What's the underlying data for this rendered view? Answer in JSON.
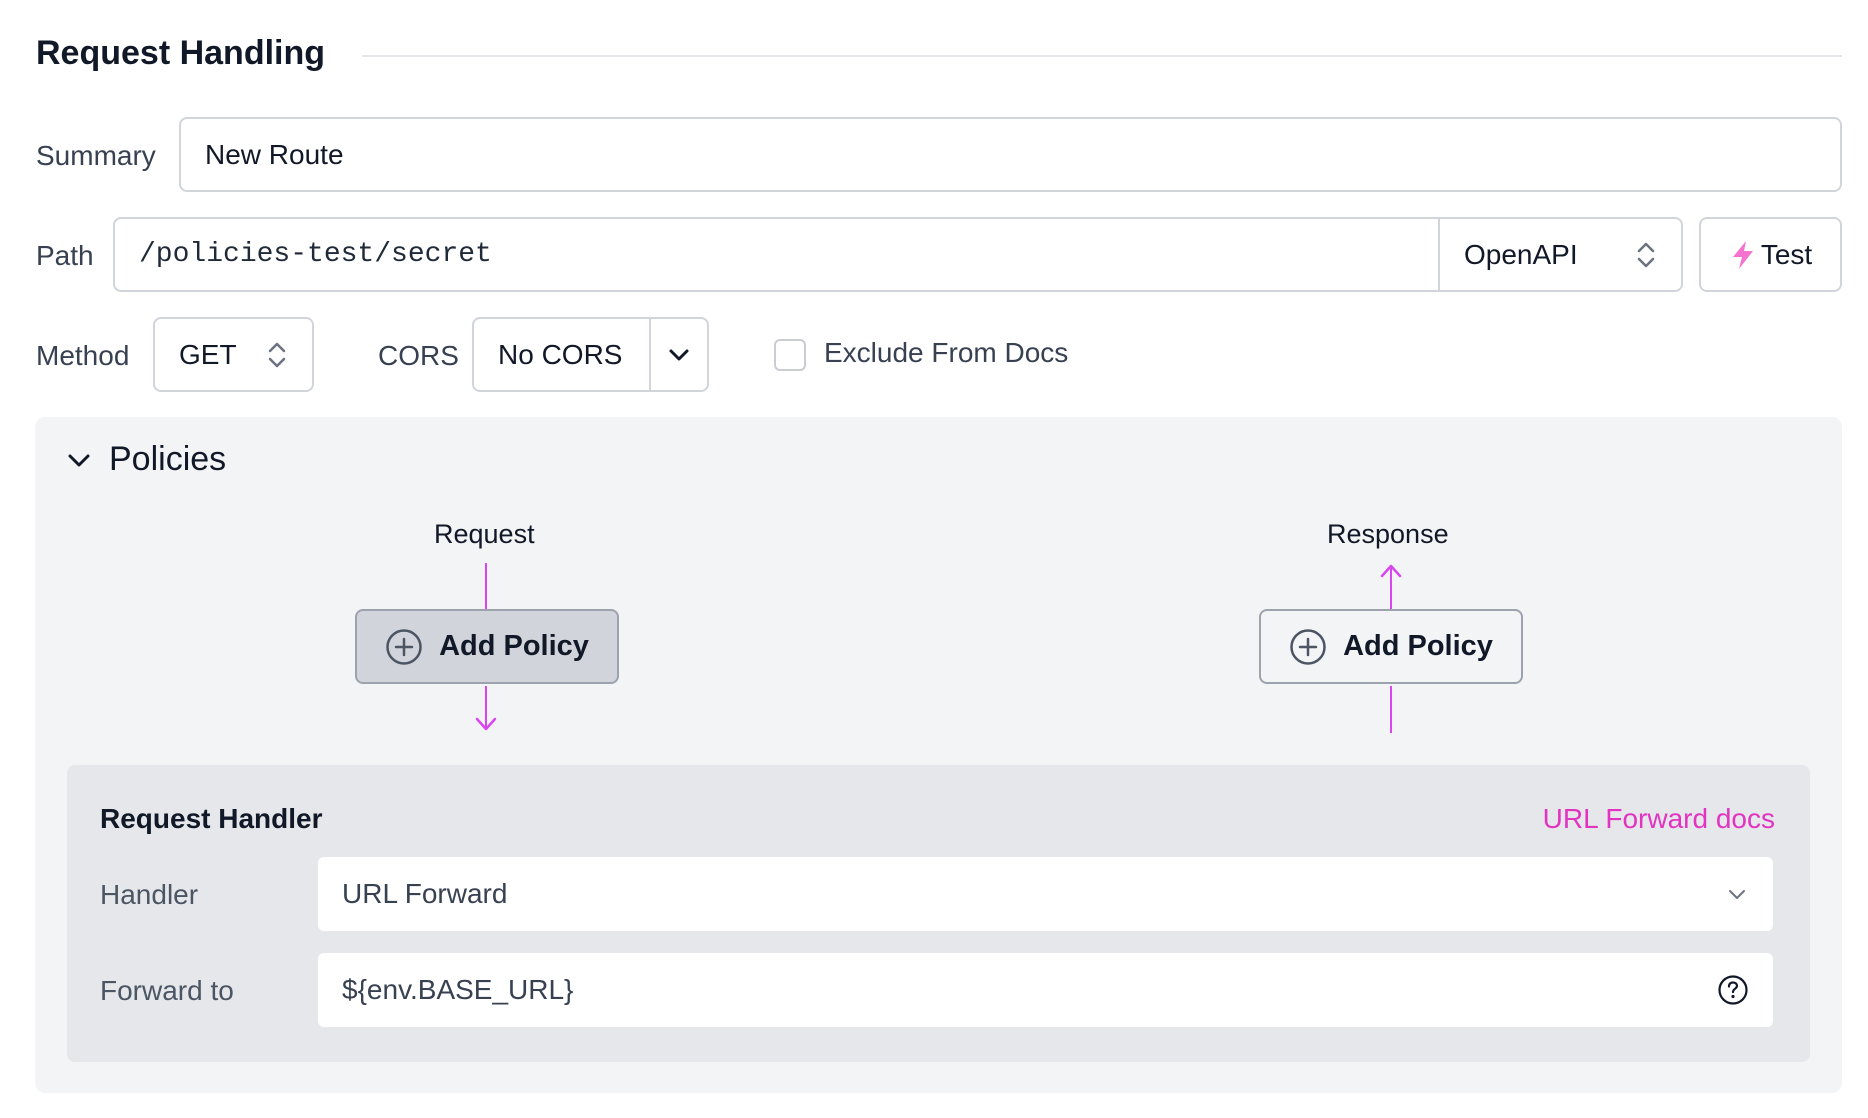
{
  "section": {
    "title": "Request Handling"
  },
  "summary": {
    "label": "Summary",
    "value": "New Route"
  },
  "path": {
    "label": "Path",
    "value": "/policies-test/secret",
    "spec_select": "OpenAPI",
    "test_label": "Test"
  },
  "method": {
    "label": "Method",
    "value": "GET"
  },
  "cors": {
    "label": "CORS",
    "value": "No CORS"
  },
  "exclude_docs": {
    "label": "Exclude From Docs",
    "checked": false
  },
  "policies": {
    "title": "Policies",
    "request_label": "Request",
    "response_label": "Response",
    "add_policy_label": "Add Policy"
  },
  "request_handler": {
    "title": "Request Handler",
    "docs_link": "URL Forward docs",
    "handler_label": "Handler",
    "handler_value": "URL Forward",
    "forward_label": "Forward to",
    "forward_value": "${env.BASE_URL}"
  },
  "colors": {
    "accent": "#d946ef",
    "link": "#e233c1"
  }
}
